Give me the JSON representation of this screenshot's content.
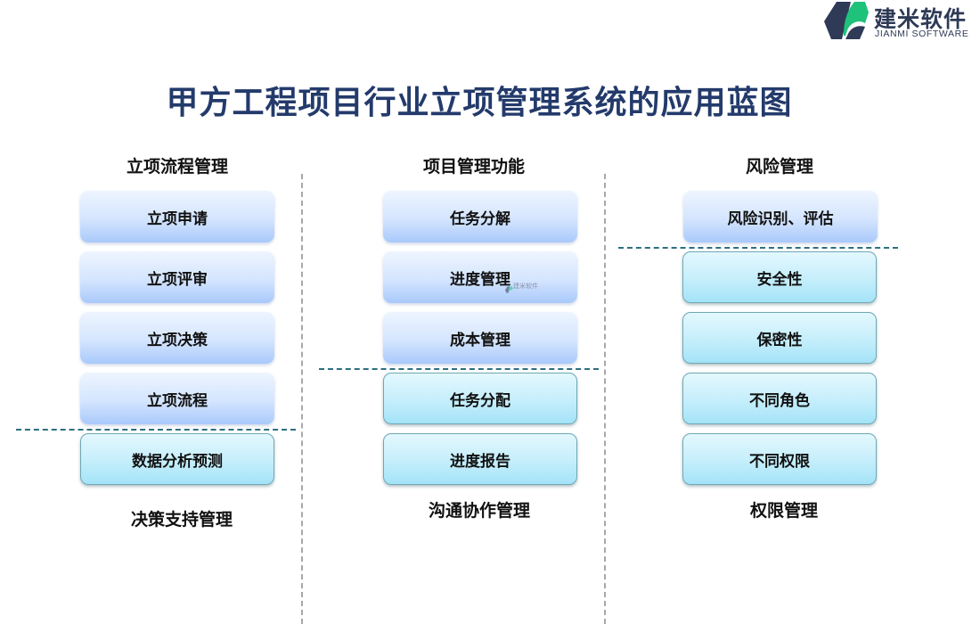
{
  "brand": {
    "name_cn": "建米软件",
    "name_en": "JIANMI SOFTWARE",
    "colors": {
      "dark": "#2e3a56",
      "green": "#1ec27a"
    }
  },
  "title": "甲方工程项目行业立项管理系统的应用蓝图",
  "columns": [
    {
      "top_heading": "立项流程管理",
      "top_items": [
        "立项申请",
        "立项评审",
        "立项决策",
        "立项流程"
      ],
      "bottom_items": [
        "数据分析预测"
      ],
      "bottom_heading": "决策支持管理"
    },
    {
      "top_heading": "项目管理功能",
      "top_items": [
        "任务分解",
        "进度管理",
        "成本管理"
      ],
      "bottom_items": [
        "任务分配",
        "进度报告"
      ],
      "bottom_heading": "沟通协作管理"
    },
    {
      "top_heading": "风险管理",
      "top_items": [
        "风险识别、评估"
      ],
      "bottom_items": [
        "安全性",
        "保密性",
        "不同角色",
        "不同权限"
      ],
      "bottom_heading": "权限管理"
    }
  ],
  "watermark": {
    "text": "建米软件"
  },
  "colors": {
    "title": "#233a6b",
    "blue_box": "#d4e5fe",
    "cyan_box": "#c5eefb",
    "section_divider": "#2d6f80",
    "column_divider": "#a8a8a8"
  }
}
